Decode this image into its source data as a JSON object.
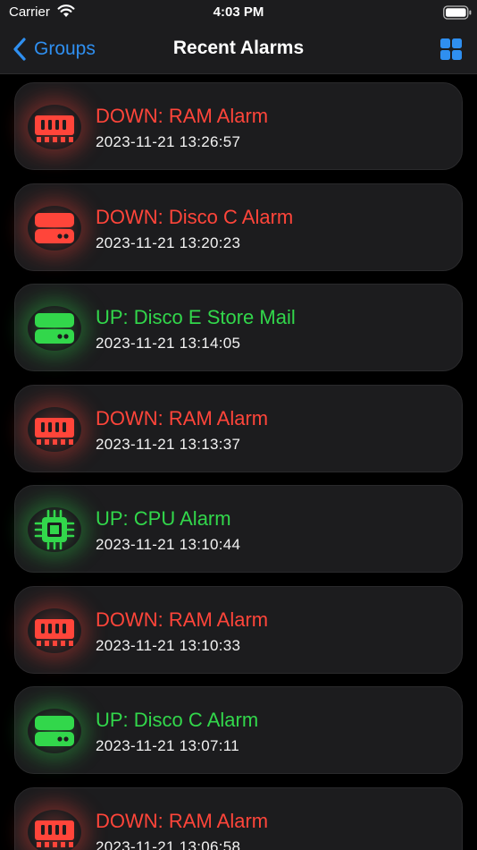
{
  "status_bar": {
    "carrier": "Carrier",
    "time": "4:03 PM"
  },
  "nav": {
    "back_label": "Groups",
    "title": "Recent Alarms",
    "accent_color": "#2f8ff0"
  },
  "colors": {
    "down": "#ff453a",
    "up": "#32d74b",
    "card_bg": "#1c1c1e"
  },
  "alarms": [
    {
      "title": "DOWN: RAM Alarm",
      "time": "2023-11-21 13:26:57",
      "status": "down",
      "icon": "ram-icon"
    },
    {
      "title": "DOWN: Disco C Alarm",
      "time": "2023-11-21 13:20:23",
      "status": "down",
      "icon": "disk-icon"
    },
    {
      "title": "UP: Disco E Store Mail",
      "time": "2023-11-21 13:14:05",
      "status": "up",
      "icon": "disk-icon"
    },
    {
      "title": "DOWN: RAM Alarm",
      "time": "2023-11-21 13:13:37",
      "status": "down",
      "icon": "ram-icon"
    },
    {
      "title": "UP: CPU Alarm",
      "time": "2023-11-21 13:10:44",
      "status": "up",
      "icon": "cpu-icon"
    },
    {
      "title": "DOWN: RAM Alarm",
      "time": "2023-11-21 13:10:33",
      "status": "down",
      "icon": "ram-icon"
    },
    {
      "title": "UP: Disco C Alarm",
      "time": "2023-11-21 13:07:11",
      "status": "up",
      "icon": "disk-icon"
    },
    {
      "title": "DOWN: RAM Alarm",
      "time": "2023-11-21 13:06:58",
      "status": "down",
      "icon": "ram-icon"
    }
  ]
}
